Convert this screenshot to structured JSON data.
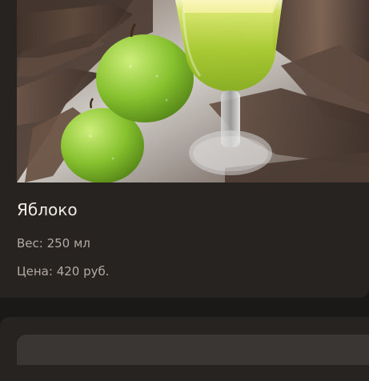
{
  "product": {
    "image_alt": "apple-juice-photo",
    "name": "Яблоко",
    "weight": "Вес: 250 мл",
    "price": "Цена: 420 руб."
  }
}
